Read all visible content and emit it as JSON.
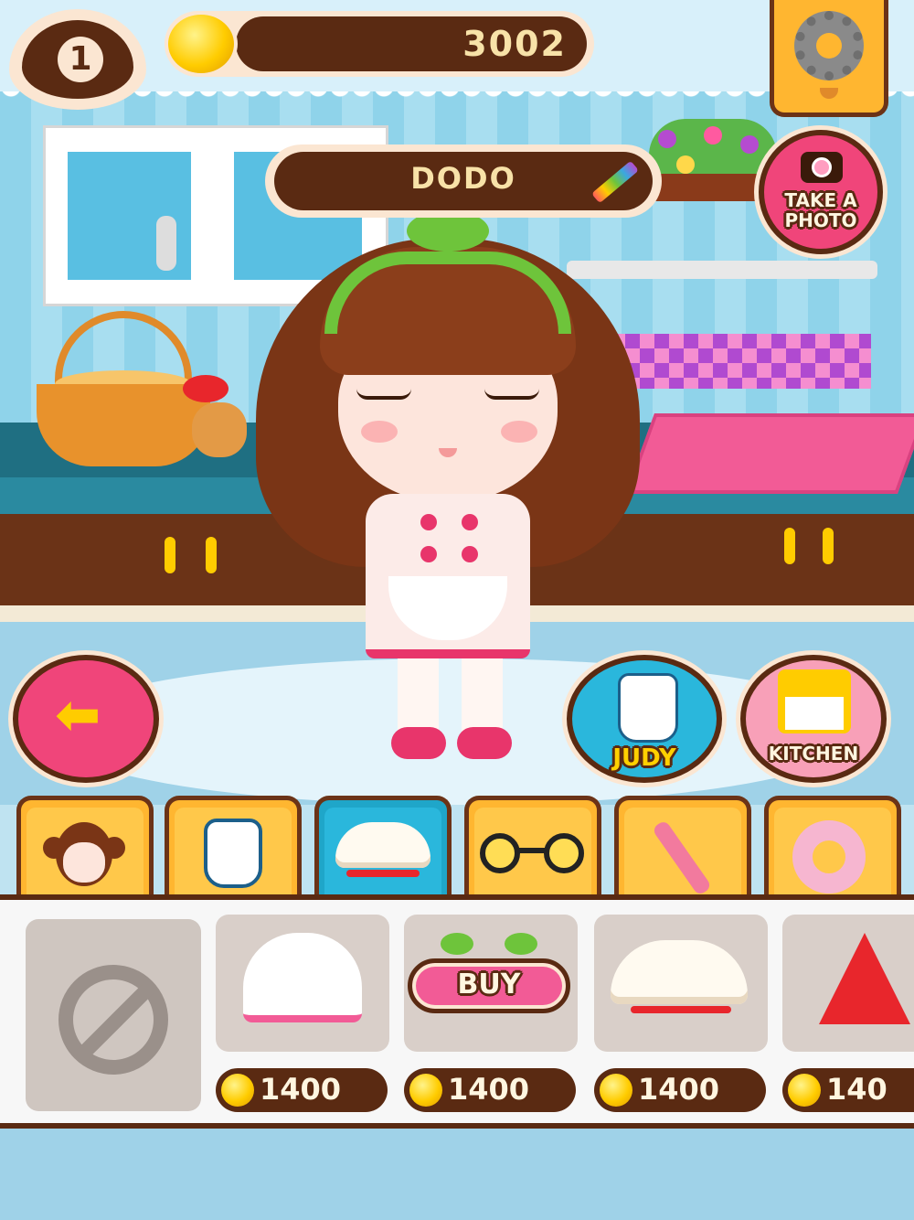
{
  "hud": {
    "lives": "1",
    "coins": "3002",
    "settings_icon": "gear-icon"
  },
  "character": {
    "name": "DODO",
    "edit_icon": "pencil-icon"
  },
  "buttons": {
    "take_photo": "TAKE A PHOTO",
    "back_icon": "arrow-left-icon",
    "judy": "JUDY",
    "kitchen": "KITCHEN"
  },
  "category_tabs": [
    {
      "name": "hair",
      "icon": "girl-face-icon"
    },
    {
      "name": "outfit",
      "icon": "apron-dress-icon"
    },
    {
      "name": "hat",
      "icon": "chef-hat-icon"
    },
    {
      "name": "glasses",
      "icon": "glasses-icon"
    },
    {
      "name": "tool",
      "icon": "fork-icon"
    },
    {
      "name": "accessory",
      "icon": "donut-icon"
    }
  ],
  "items": [
    {
      "icon": "none-icon",
      "price": null
    },
    {
      "icon": "white-cap-icon",
      "price": "1400"
    },
    {
      "icon": "headband-icon",
      "price": "1400",
      "button": "BUY"
    },
    {
      "icon": "chef-hat-icon",
      "price": "1400"
    },
    {
      "icon": "party-hat-icon",
      "price": "140"
    }
  ],
  "colors": {
    "brown": "#5a2a12",
    "orange": "#ffb630",
    "pink": "#f0457a",
    "teal": "#1fa6c9"
  }
}
